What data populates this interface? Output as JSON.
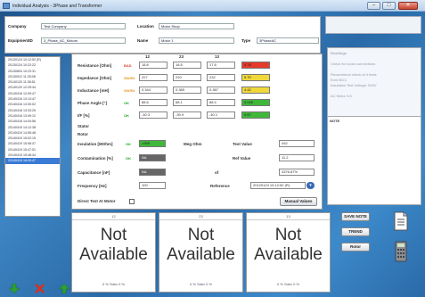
{
  "window": {
    "title": "Individual Analysis - 3Phase and Transformer"
  },
  "header": {
    "company_label": "Company",
    "company_value": "Test Company",
    "location_label": "Location",
    "location_value": "Motor Shop",
    "equip_label": "EquipmentID",
    "equip_value": "3_Phase_AC_Motors",
    "name_label": "Name",
    "name_value": "Motor 1",
    "type_label": "Type",
    "type_value": "3PhaseAC"
  },
  "side_header": "Readings",
  "side_info": [
    "Check for loose connections",
    "Recommend check at 4 tests",
    "from MCC",
    "Insulation Test Voltage: 500V",
    "AC Motor 3-K"
  ],
  "note_label": "NOTE",
  "tests": [
    "20130124 10:12:52 (R)",
    "20130124 10:22:22",
    "20130804 10:23:31",
    "20130912 11:25:08",
    "20140120 11:38:51",
    "20140120 12:25:44",
    "20140416 12:09:47",
    "20140416 13:13:47",
    "20140416 13:30:02",
    "20140416 13:33:25",
    "20140416 13:49:12",
    "20140416 14:04:56",
    "20140419 14:12:38",
    "20140419 14:55:48",
    "20140419 15:02:15",
    "20140419 15:08:47",
    "20140419 15:47:51",
    "20140419 15:48:44",
    "20140419 16:00:47"
  ],
  "selected_test_index": 18,
  "main": {
    "cols": [
      "12",
      "23",
      "13"
    ],
    "rows": [
      {
        "label": "Resistance [Ohm]",
        "status": "BAD",
        "status_class": "bad",
        "values": [
          "18.8",
          "18.8",
          "17.8"
        ],
        "ind_text": "0.78",
        "ind_color": "#e63a2a"
      },
      {
        "label": "Impedance [Ohm]",
        "status": "WARN",
        "status_class": "warn",
        "values": [
          "227",
          "220",
          "232"
        ],
        "ind_text": "5.70",
        "ind_color": "#f0d83a"
      },
      {
        "label": "Inductance [mH]",
        "status": "WARN",
        "status_class": "warn",
        "values": [
          "0.344",
          "0.389",
          "0.387"
        ],
        "ind_text": "4.42",
        "ind_color": "#f0d83a"
      },
      {
        "label": "Phase Angle [°]",
        "status": "OK",
        "status_class": "ok",
        "values": [
          "88.6",
          "88.1",
          "88.4"
        ],
        "ind_text": "0.046",
        "ind_color": "#3fb83a"
      },
      {
        "label": "I/F [%]",
        "status": "OK",
        "status_class": "ok",
        "values": [
          "-40.3",
          "-39.9",
          "-40.1"
        ],
        "ind_text": "0.67",
        "ind_color": "#3fb83a"
      }
    ],
    "stator_label": "Stator",
    "rotor_label": "Rotor",
    "insulation_label": "Insulation [MOhm]",
    "insulation_status": "OK",
    "insulation_value": ">999",
    "meg_label": "Meg Ohm",
    "test_value_label": "Test Value",
    "test_value": "492",
    "contamination_label": "Contamination [%]",
    "contamination_status": "OK",
    "contamination_value": "NA",
    "ref_value_label": "Ref Value",
    "ref_value": "11.2",
    "capacitance_label": "Capacitance [nF]",
    "capacitance_value": "NA",
    "of_label": "of",
    "of_value": "4376.87%",
    "frequency_label": "Frequency [Hz]",
    "frequency_value": "100",
    "reference_label": "Reference",
    "reference_value": "20120124 10:12:52 (R)",
    "direct_test_label": "Direct Test At Motor",
    "manual_values_label": "Manual Values"
  },
  "cards": [
    {
      "header": "12",
      "text_line1": "Not",
      "text_line2": "Available",
      "footer": "0 %   Sdev 0 %"
    },
    {
      "header": "23",
      "text_line1": "Not",
      "text_line2": "Available",
      "footer": "0 %   Sdev 0 %"
    },
    {
      "header": "13",
      "text_line1": "Not",
      "text_line2": "Available",
      "footer": "0 %   Sdev 0 %"
    }
  ],
  "buttons": {
    "save_note": "SAVE NOTE",
    "trend": "TREND",
    "rotor": "Rotor"
  },
  "colors": {
    "bad": "#e63a2a",
    "warn": "#f0d83a",
    "ok": "#3fb83a",
    "selected": "#3a7bd5"
  },
  "icons": {
    "down": "arrow-down-icon",
    "delete": "delete-x-icon",
    "up": "arrow-up-icon",
    "report": "document-icon",
    "calculator": "calculator-icon"
  }
}
